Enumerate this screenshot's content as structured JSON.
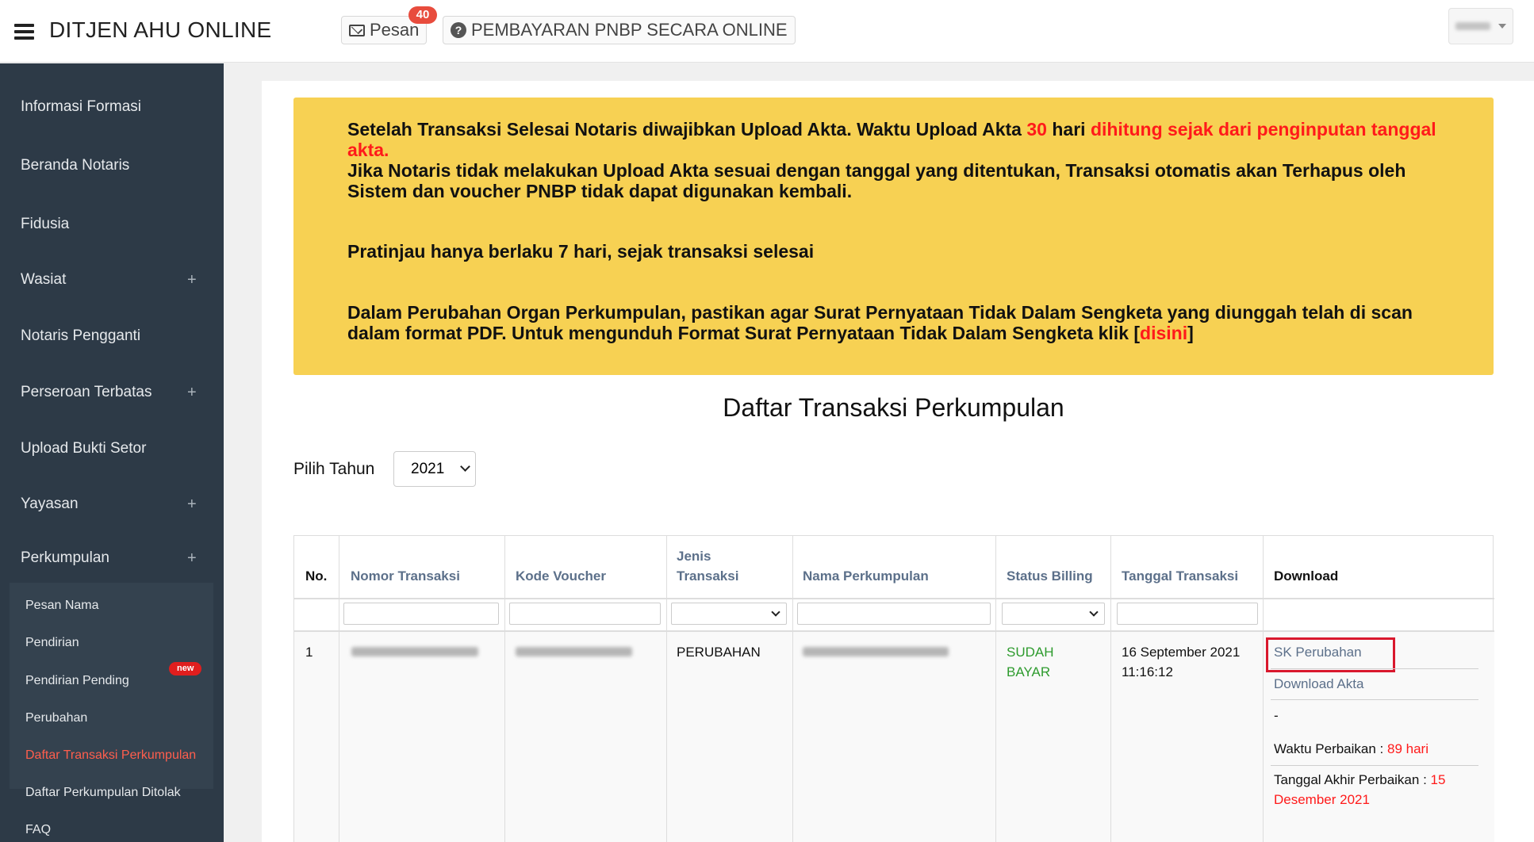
{
  "header": {
    "brand": "DITJEN AHU ONLINE",
    "pesan_label": "Pesan",
    "pesan_count": "40",
    "pnbp_label": "PEMBAYARAN PNBP SECARA ONLINE"
  },
  "sidebar": {
    "items": [
      {
        "label": "Informasi Formasi"
      },
      {
        "label": "Beranda Notaris"
      },
      {
        "label": "Fidusia"
      },
      {
        "label": "Wasiat",
        "expand": "+"
      },
      {
        "label": "Notaris Pengganti"
      },
      {
        "label": "Perseroan Terbatas",
        "expand": "+"
      },
      {
        "label": "Upload Bukti Setor"
      },
      {
        "label": "Yayasan",
        "expand": "+"
      },
      {
        "label": "Perkumpulan",
        "expand": "+"
      }
    ],
    "submenu": [
      {
        "label": "Pesan Nama"
      },
      {
        "label": "Pendirian"
      },
      {
        "label": "Pendirian Pending"
      },
      {
        "label": "Perubahan"
      },
      {
        "label": "Daftar Transaksi Perkumpulan"
      },
      {
        "label": "Daftar Perkumpulan Ditolak"
      },
      {
        "label": "FAQ"
      }
    ],
    "new_badge": "new"
  },
  "notice": {
    "p1_a": "Setelah Transaksi Selesai Notaris diwajibkan Upload Akta. Waktu Upload Akta ",
    "p1_days": "30",
    "p1_b": " hari ",
    "p1_c": "dihitung sejak dari penginputan tanggal akta.",
    "p2": "Jika Notaris tidak melakukan Upload Akta sesuai dengan tanggal yang ditentukan, Transaksi otomatis akan Terhapus oleh Sistem dan voucher PNBP tidak dapat digunakan kembali.",
    "p3": "Pratinjau hanya berlaku 7 hari, sejak transaksi selesai",
    "p4_a": "Dalam Perubahan Organ Perkumpulan, pastikan agar Surat Pernyataan Tidak Dalam Sengketa yang diunggah telah di scan dalam format PDF. Untuk mengunduh Format Surat Pernyataan Tidak Dalam Sengketa klik [",
    "p4_link": "disini",
    "p4_b": "]"
  },
  "page": {
    "title": "Daftar Transaksi Perkumpulan",
    "year_label": "Pilih Tahun",
    "year_value": "2021"
  },
  "table": {
    "headers": {
      "no": "No.",
      "nomor": "Nomor Transaksi",
      "voucher": "Kode Voucher",
      "jenis": "Jenis Transaksi",
      "nama": "Nama Perkumpulan",
      "status": "Status Billing",
      "tanggal": "Tanggal Transaksi",
      "download": "Download"
    },
    "row": {
      "no": "1",
      "jenis": "PERUBAHAN",
      "status": "SUDAH BAYAR",
      "tanggal": "16 September 2021 11:16:12",
      "dl_sk": "SK Perubahan",
      "dl_akta": "Download Akta",
      "dash": "-",
      "waktu_label": "Waktu Perbaikan : ",
      "waktu_value": "89 hari",
      "akhir_label": "Tanggal Akhir Perbaikan : ",
      "akhir_value": "15 Desember 2021"
    }
  },
  "colors": {
    "sidebar_bg": "#2d3a47",
    "notice_bg": "#f7d153",
    "accent_red": "#ff1a1a",
    "link": "#5c708a",
    "status_green": "#2e9b2e"
  }
}
